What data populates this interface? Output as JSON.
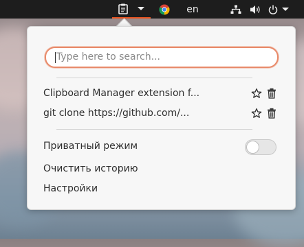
{
  "topbar": {
    "clipboard_icon": "clipboard-icon",
    "dropdown_icon": "chevron-down-icon",
    "chrome_icon": "chrome-icon",
    "language": "en",
    "network_icon": "network-icon",
    "volume_icon": "volume-icon",
    "power_icon": "power-icon"
  },
  "popup": {
    "search_placeholder": "Type here to search...",
    "history": [
      {
        "text": "Clipboard Manager extension f...",
        "star_icon": "star-icon",
        "delete_icon": "trash-icon"
      },
      {
        "text": "git clone https://github.com/...",
        "star_icon": "star-icon",
        "delete_icon": "trash-icon"
      }
    ],
    "private_mode_label": "Приватный режим",
    "private_mode_on": false,
    "clear_history_label": "Очистить историю",
    "settings_label": "Настройки"
  },
  "colors": {
    "accent": "#e95420",
    "panel_bg": "#1d1d1d",
    "popup_bg": "#f7f7f7",
    "text": "#2e2e2e"
  }
}
